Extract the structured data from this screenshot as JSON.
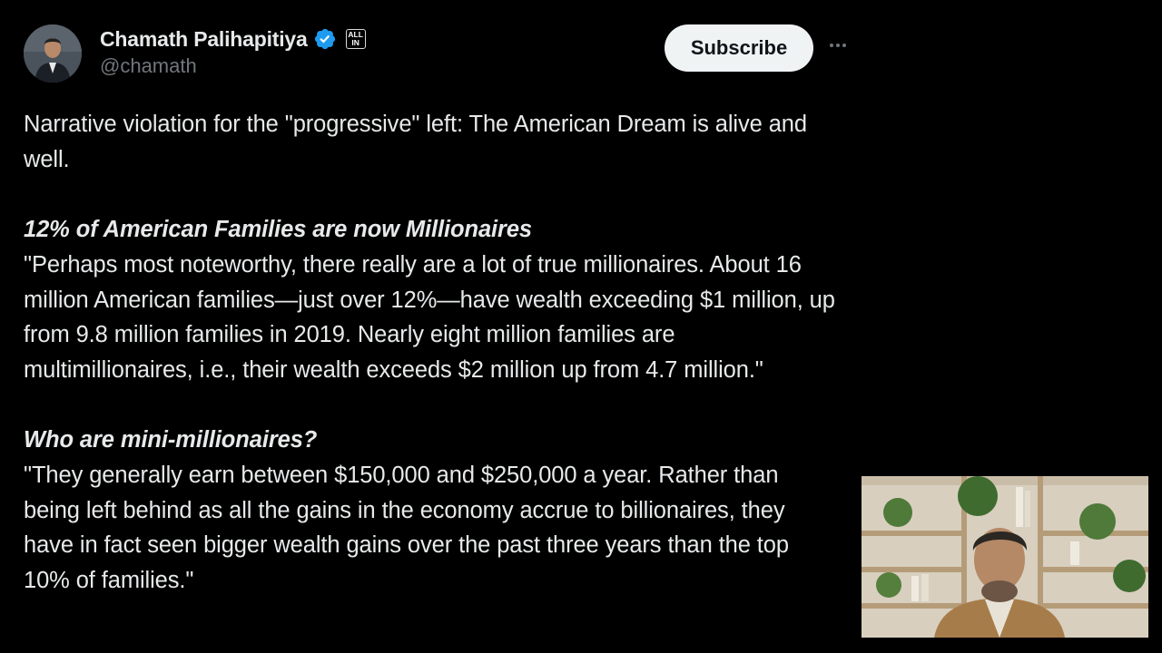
{
  "author": {
    "display_name": "Chamath Palihapitiya",
    "handle": "@chamath",
    "affiliate_badge": "ALL IN",
    "verified_color": "#1d9bf0"
  },
  "actions": {
    "subscribe_label": "Subscribe",
    "more_label": "···"
  },
  "tweet": {
    "intro": "Narrative violation for the \"progressive\" left: The American Dream is alive and well.",
    "section1_heading": "12% of American Families are now Millionaires",
    "section1_quote": "\"Perhaps most noteworthy, there really are a lot of true millionaires. About 16 million American families—just over 12%—have wealth exceeding $1 million, up from 9.8 million families in 2019. Nearly eight million families are multimillionaires, i.e., their wealth exceeds $2 million up from 4.7 million.\"",
    "section2_heading": "Who are mini-millionaires?",
    "section2_quote": "\"They generally earn between $150,000 and $250,000 a year.  Rather than being left behind as all the gains in the economy accrue to billionaires, they have in fact seen bigger wealth gains over the past three years than the top 10% of families.\""
  },
  "colors": {
    "background": "#000000",
    "text": "#e7e9ea",
    "secondary_text": "#71767b",
    "subscribe_bg": "#eff3f4"
  }
}
